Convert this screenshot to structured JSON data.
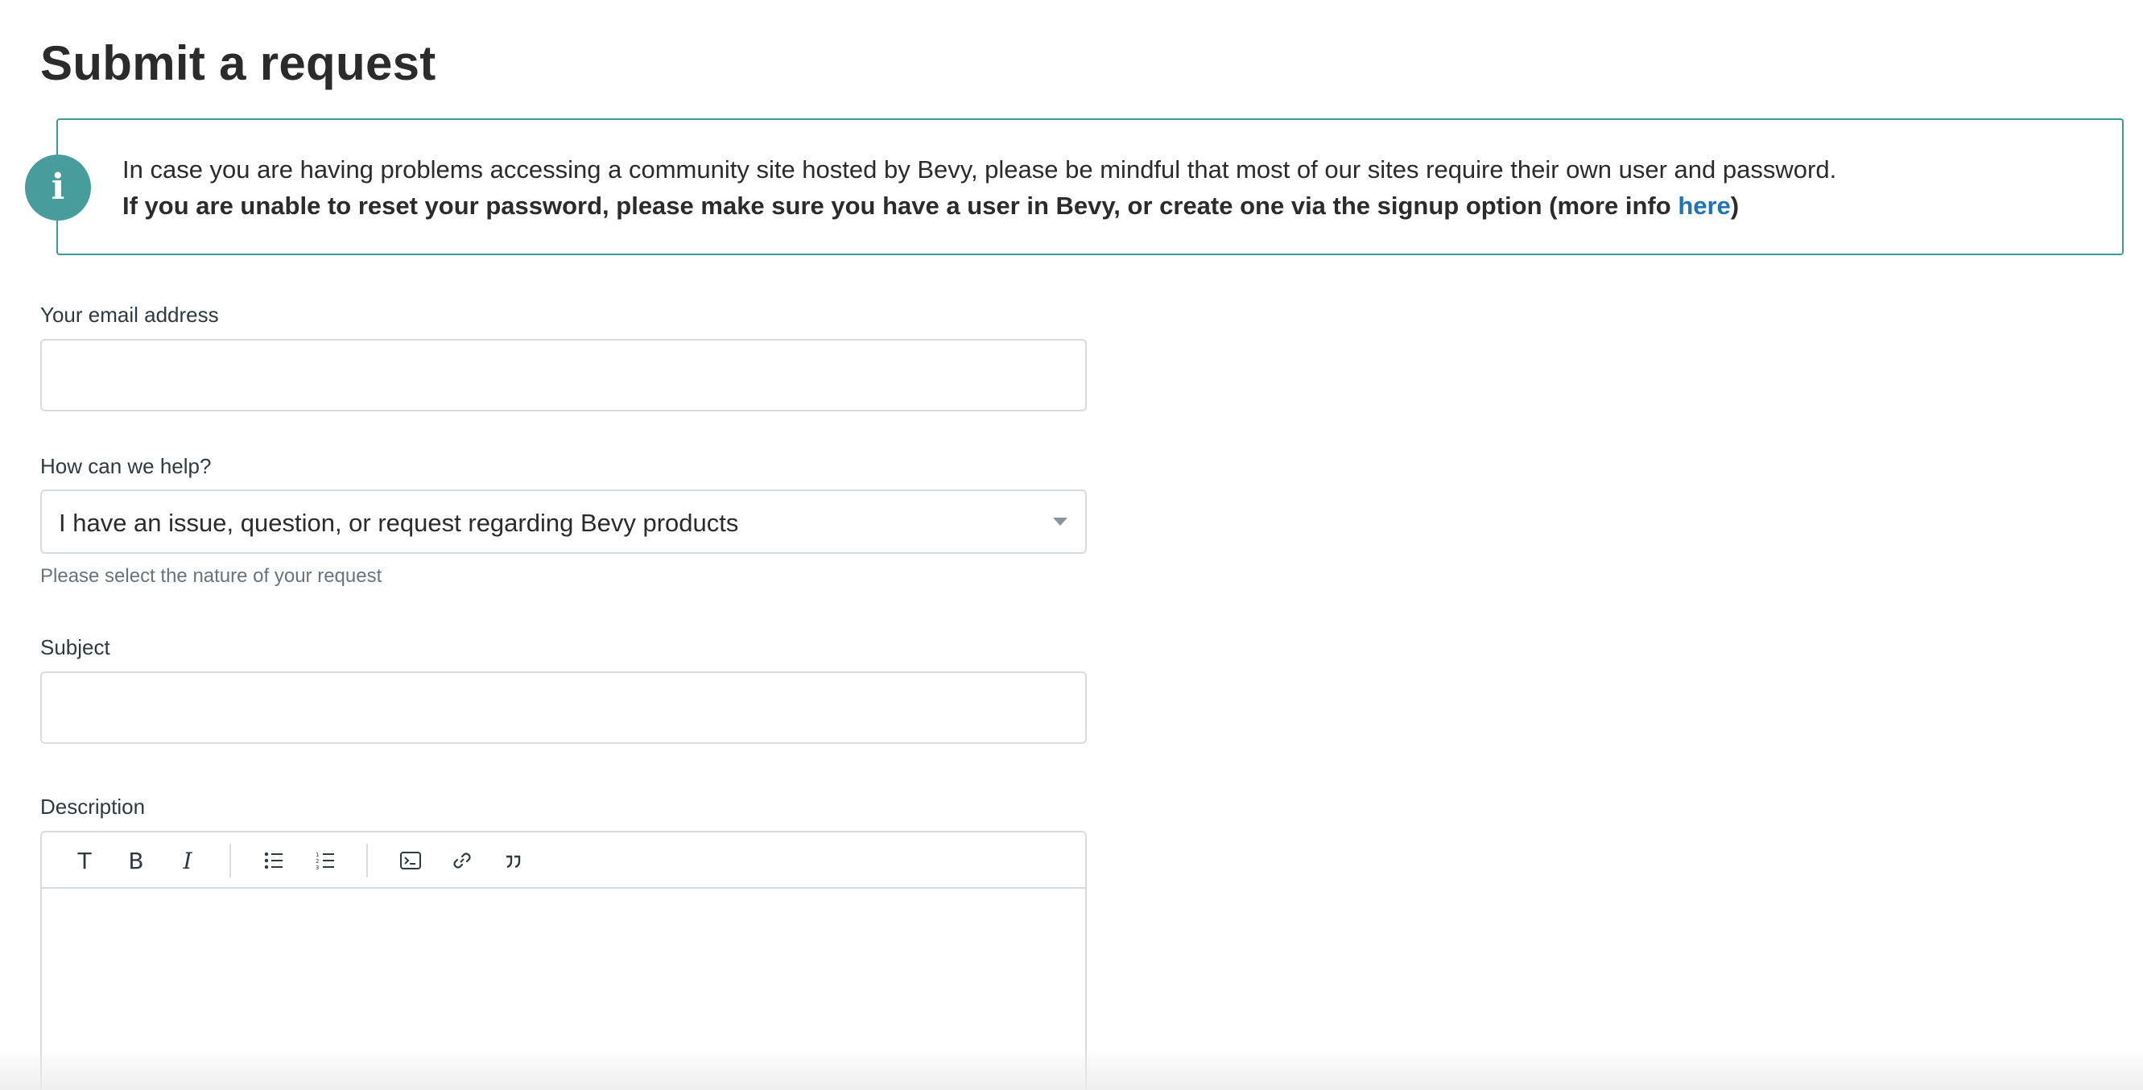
{
  "page": {
    "title": "Submit a request"
  },
  "notice": {
    "icon": "info-icon",
    "icon_glyph": "i",
    "line1": "In case you are having problems accessing a community site hosted by Bevy, please be mindful that most of our sites require their own user and password.",
    "line2_prefix": "If you are unable to reset your password, please make sure you have a user in Bevy, or create one via the signup option (more info ",
    "link_text": "here",
    "line2_suffix": ")",
    "accent_color": "#469d9c",
    "link_color": "#1f73b7"
  },
  "form": {
    "email": {
      "label": "Your email address",
      "value": "",
      "placeholder": ""
    },
    "help": {
      "label": "How can we help?",
      "selected": "I have an issue, question, or request regarding Bevy products",
      "hint": "Please select the nature of your request"
    },
    "subject": {
      "label": "Subject",
      "value": "",
      "placeholder": ""
    },
    "description": {
      "label": "Description",
      "toolbar": [
        {
          "name": "text-format-icon",
          "glyph": "T"
        },
        {
          "name": "bold-icon",
          "glyph": "B"
        },
        {
          "name": "italic-icon",
          "glyph": "I"
        },
        {
          "name": "bulleted-list-icon"
        },
        {
          "name": "numbered-list-icon"
        },
        {
          "name": "code-block-icon"
        },
        {
          "name": "link-icon"
        },
        {
          "name": "quote-icon"
        }
      ]
    }
  }
}
